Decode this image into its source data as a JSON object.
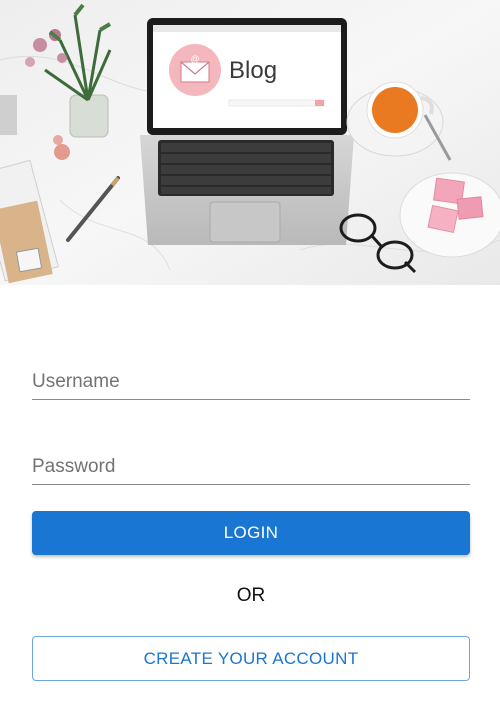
{
  "hero": {
    "screen_heading": "Blog"
  },
  "form": {
    "username_placeholder": "Username",
    "password_placeholder": "Password",
    "login_label": "LOGIN",
    "or_label": "OR",
    "create_label": "CREATE YOUR ACCOUNT"
  },
  "colors": {
    "primary": "#1976d2",
    "outline": "#6fa3dc"
  }
}
